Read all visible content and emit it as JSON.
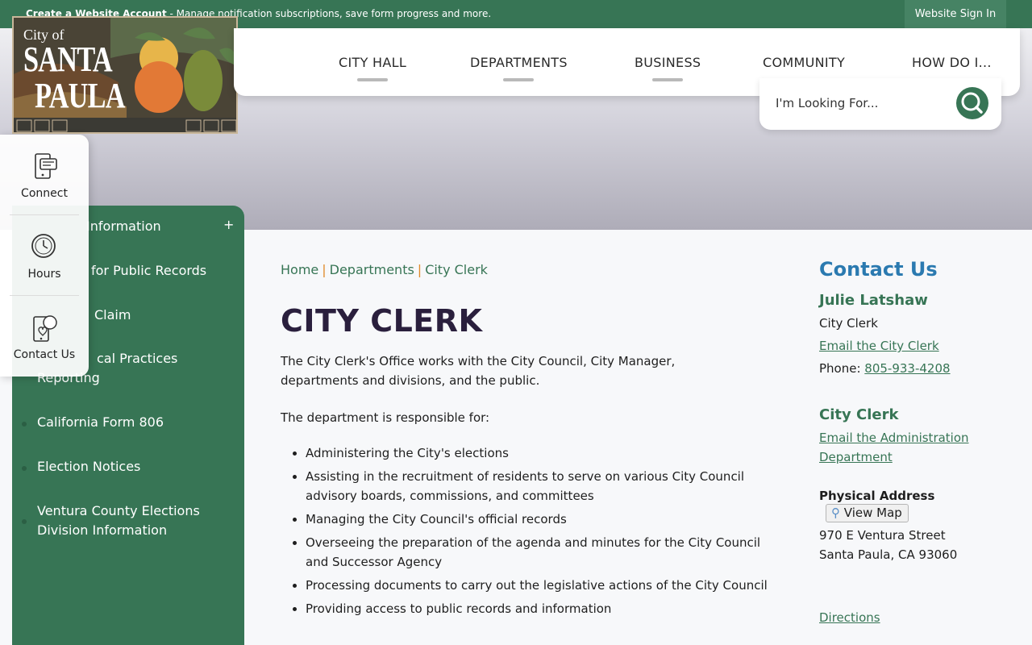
{
  "topbar": {
    "account_title": "Create a Website Account",
    "account_desc": " - Manage notification subscriptions, save form progress and more.",
    "signin": "Website Sign In"
  },
  "logo": {
    "line1": "City of",
    "line2": "SANTA",
    "line3": "PAULA"
  },
  "nav": [
    "CITY HALL",
    "DEPARTMENTS",
    "BUSINESS",
    "COMMUNITY",
    "HOW DO I..."
  ],
  "search": {
    "placeholder": "I'm Looking For..."
  },
  "quick_links": [
    "Connect",
    "Hours",
    "Contact Us"
  ],
  "sidemenu": {
    "items": [
      "Information",
      "for Public Records",
      "Claim",
      "cal Practices Reporting",
      "California Form 806",
      "Election Notices",
      "Ventura County Elections Division Information"
    ],
    "expand": "+"
  },
  "breadcrumb": [
    "Home",
    "Departments",
    "City Clerk"
  ],
  "breadcrumb_sep": "|",
  "page": {
    "title": "CITY CLERK",
    "intro": "The City Clerk's Office works with the City Council, City Manager, departments and divisions, and the public.",
    "responsible": "The department is responsible for:",
    "duties": [
      "Administering the City's elections",
      "Assisting in the recruitment of residents to serve on various City Council advisory boards, commissions, and committees",
      "Managing the City Council's official records",
      "Overseeing the preparation of the agenda and minutes for the City Council and Successor Agency",
      "Processing documents to carry out the legislative actions of the City Council",
      "Providing access to public records and information"
    ]
  },
  "contact": {
    "heading": "Contact Us",
    "person": "Julie Latshaw",
    "role": "City Clerk",
    "email_clerk": "Email the City Clerk",
    "phone_label": "Phone: ",
    "phone": "805-933-4208",
    "dept_name": "City Clerk",
    "email_admin": "Email the Administration Department",
    "address_label": "Physical Address",
    "view_map": "View Map",
    "street": "970 E Ventura Street",
    "city": "Santa Paula, CA 93060",
    "directions": "Directions"
  },
  "colors": {
    "brand_green": "#377555",
    "heading_blue": "#2b7ab0",
    "title_purple": "#2a1f3d",
    "crumb_sep": "#e08a2a"
  }
}
